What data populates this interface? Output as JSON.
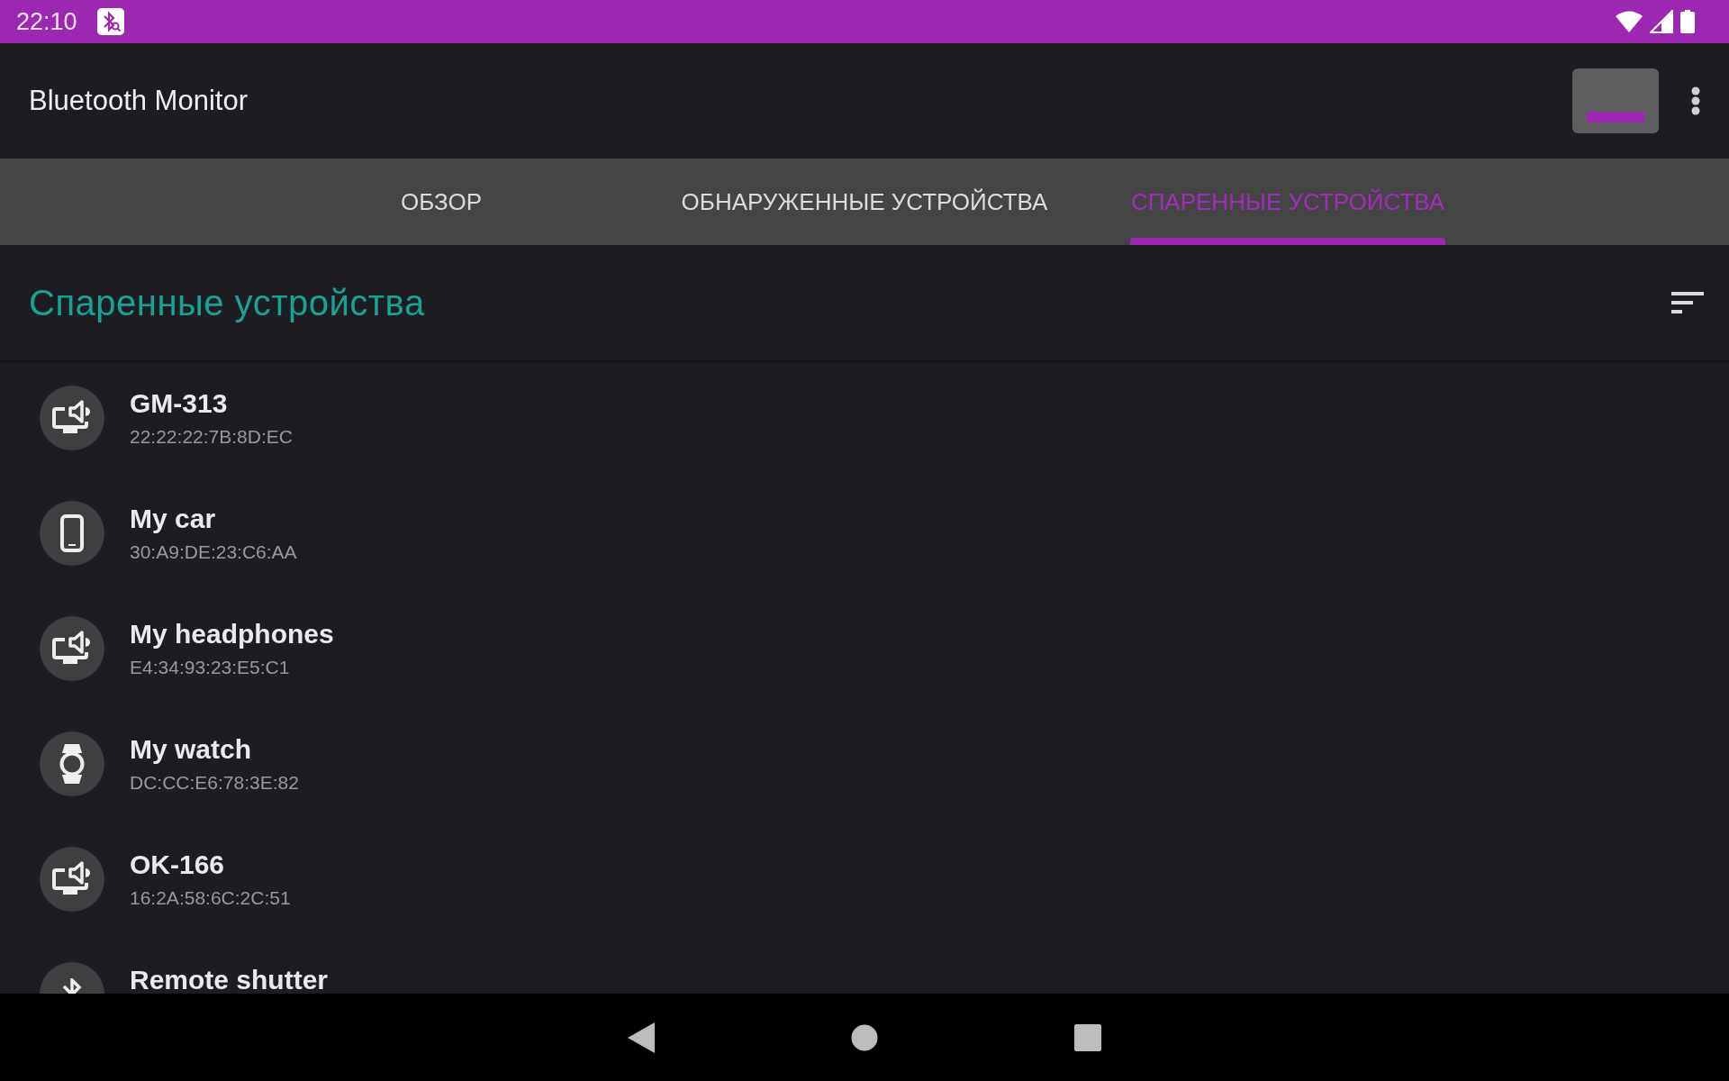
{
  "status_bar": {
    "time": "22:10"
  },
  "app_bar": {
    "title": "Bluetooth Monitor"
  },
  "tabs": [
    {
      "label": "ОБЗОР",
      "selected": false
    },
    {
      "label": "ОБНАРУЖЕННЫЕ УСТРОЙСТВА",
      "selected": false
    },
    {
      "label": "СПАРЕННЫЕ УСТРОЙСТВА",
      "selected": true
    }
  ],
  "section": {
    "title": "Спаренные устройства"
  },
  "devices": [
    {
      "kind": "speaker",
      "name": "GM-313",
      "address": "22:22:22:7B:8D:EC"
    },
    {
      "kind": "phone",
      "name": "My car",
      "address": "30:A9:DE:23:C6:AA"
    },
    {
      "kind": "speaker",
      "name": "My headphones",
      "address": "E4:34:93:23:E5:C1"
    },
    {
      "kind": "watch",
      "name": "My watch",
      "address": "DC:CC:E6:78:3E:82"
    },
    {
      "kind": "speaker",
      "name": "OK-166",
      "address": "16:2A:58:6C:2C:51"
    },
    {
      "kind": "bluetooth",
      "name": "Remote shutter"
    }
  ]
}
